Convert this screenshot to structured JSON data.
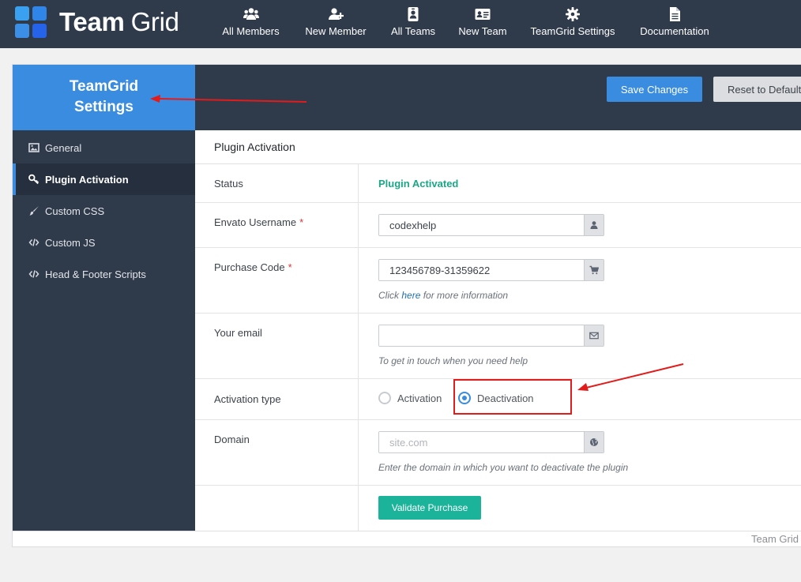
{
  "topbar": {
    "logo": {
      "word1": "Team",
      "word2": "Grid",
      "tile_colors": [
        "#3aa0f0",
        "#2f86e8",
        "#3b8fe6",
        "#2563eb"
      ]
    },
    "nav": [
      {
        "label": "All Members",
        "icon": "users-icon"
      },
      {
        "label": "New Member",
        "icon": "user-plus-icon"
      },
      {
        "label": "All Teams",
        "icon": "id-badge-icon"
      },
      {
        "label": "New Team",
        "icon": "id-card-icon"
      },
      {
        "label": "TeamGrid Settings",
        "icon": "gear-icon"
      },
      {
        "label": "Documentation",
        "icon": "document-icon"
      }
    ]
  },
  "panel": {
    "title_line1": "TeamGrid",
    "title_line2": "Settings",
    "save_label": "Save Changes",
    "reset_label": "Reset to Defaults"
  },
  "sidebar": {
    "items": [
      {
        "label": "General",
        "icon": "image-icon",
        "active": false
      },
      {
        "label": "Plugin Activation",
        "icon": "key-icon",
        "active": true
      },
      {
        "label": "Custom CSS",
        "icon": "brush-icon",
        "active": false
      },
      {
        "label": "Custom JS",
        "icon": "code-icon",
        "active": false
      },
      {
        "label": "Head & Footer Scripts",
        "icon": "code-icon",
        "active": false
      }
    ]
  },
  "section": {
    "title": "Plugin Activation",
    "status": {
      "label": "Status",
      "value": "Plugin Activated"
    },
    "username": {
      "label": "Envato Username",
      "required_mark": "*",
      "value": "codexhelp",
      "icon": "user-icon"
    },
    "purchase": {
      "label": "Purchase Code",
      "required_mark": "*",
      "value": "123456789-31359622",
      "icon": "cart-icon",
      "help_prefix": "Click",
      "help_link": "here",
      "help_suffix": "for more information"
    },
    "email": {
      "label": "Your email",
      "value": "",
      "icon": "envelope-icon",
      "help": "To get in touch when you need help"
    },
    "activation": {
      "label": "Activation type",
      "options": [
        "Activation",
        "Deactivation"
      ],
      "selected": "Deactivation"
    },
    "domain": {
      "label": "Domain",
      "placeholder": "site.com",
      "icon": "globe-icon",
      "help": "Enter the domain in which you want to deactivate the plugin"
    },
    "validate_label": "Validate Purchase"
  },
  "footer": {
    "text": "Team Grid"
  },
  "colors": {
    "accent": "#3a8ce0",
    "dark": "#2f3a4b",
    "success": "#1ba785",
    "teal_button": "#1bb39a",
    "annotation_red": "#e21b1b"
  }
}
